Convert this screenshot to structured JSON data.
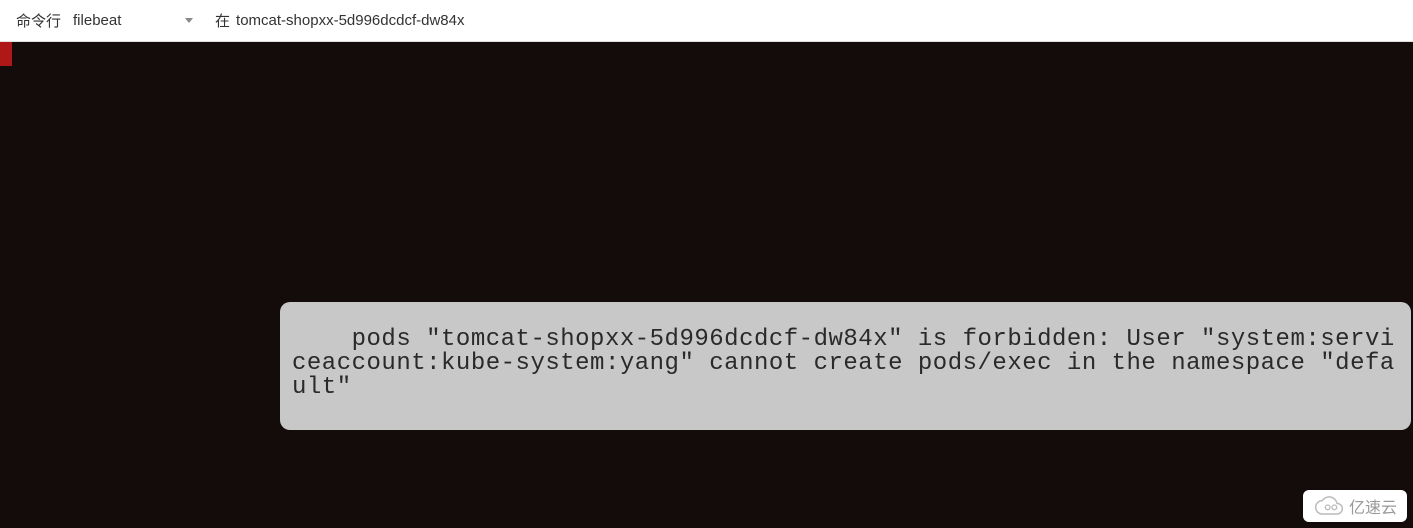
{
  "header": {
    "label": "命令行",
    "dropdown_value": "filebeat",
    "location_label": "在",
    "location_value": "tomcat-shopxx-5d996dcdcf-dw84x"
  },
  "terminal": {
    "error_message": "pods \"tomcat-shopxx-5d996dcdcf-dw84x\" is forbidden: User \"system:serviceaccount:kube-system:yang\" cannot create pods/exec in the namespace \"default\""
  },
  "watermark": {
    "text": "亿速云"
  }
}
